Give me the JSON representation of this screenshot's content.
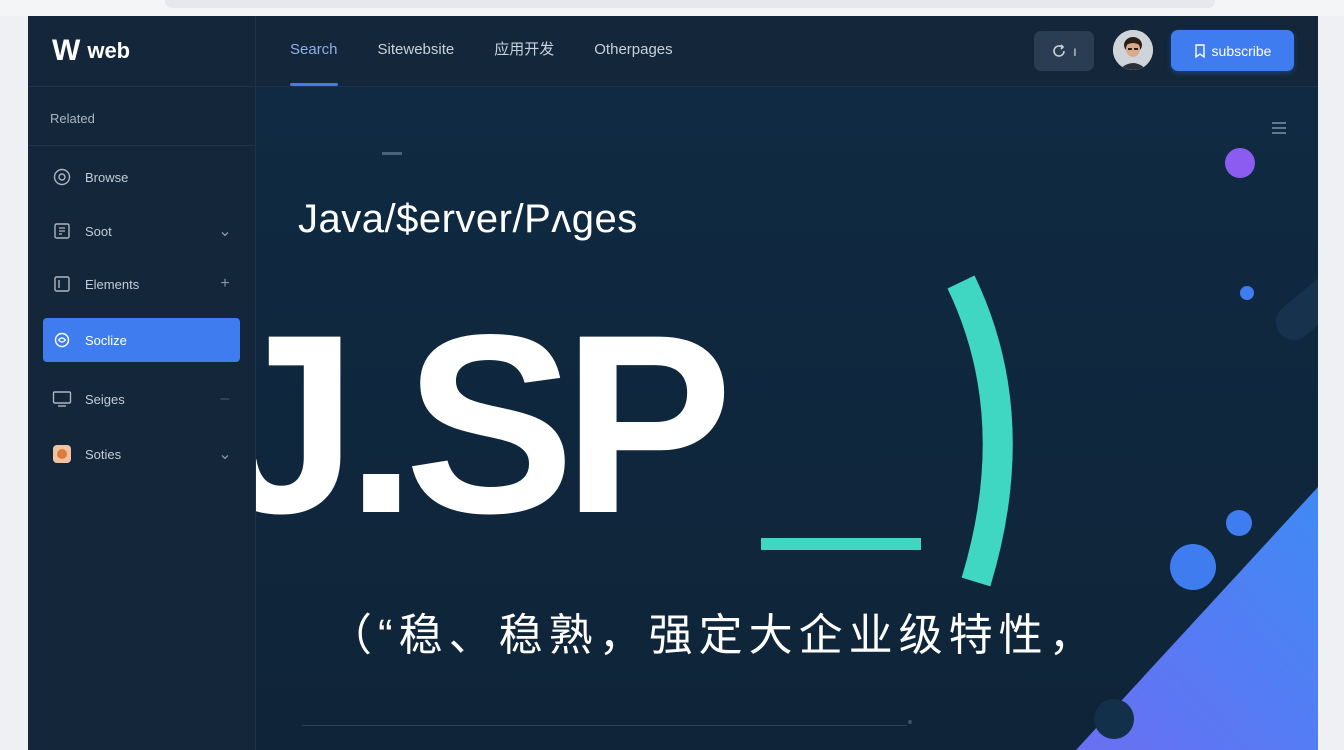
{
  "header": {
    "brand_logo": "W",
    "brand_name": "web",
    "nav": [
      "Search",
      "Sitewebsite",
      "应用开发",
      "Otherpages"
    ],
    "active_nav_index": 0,
    "icon_button_label": "ı",
    "primary_button_label": "subscribe"
  },
  "sidebar": {
    "header": "Related",
    "items": [
      {
        "label": "Browse",
        "icon": "target-icon",
        "trail": ""
      },
      {
        "label": "Soot",
        "icon": "doc-icon",
        "trail": "⌄"
      },
      {
        "label": "Elements",
        "icon": "frame-icon",
        "trail": "+"
      },
      {
        "label": "Soclize",
        "icon": "globe-icon",
        "trail": "",
        "active": true
      },
      {
        "label": "Seiges",
        "icon": "monitor-icon",
        "trail": "–"
      },
      {
        "label": "Soties",
        "icon": "app-icon",
        "trail": "⌄"
      }
    ]
  },
  "hero": {
    "subtitle": "Java/$erver/Pʌges",
    "title": "J.SP",
    "tagline": "（“稳、稳熟，强定大企业级特性，"
  },
  "colors": {
    "accent": "#3f7cf0",
    "teal": "#3fd6c2",
    "purple": "#8c5cf0",
    "background": "#0f2236"
  }
}
